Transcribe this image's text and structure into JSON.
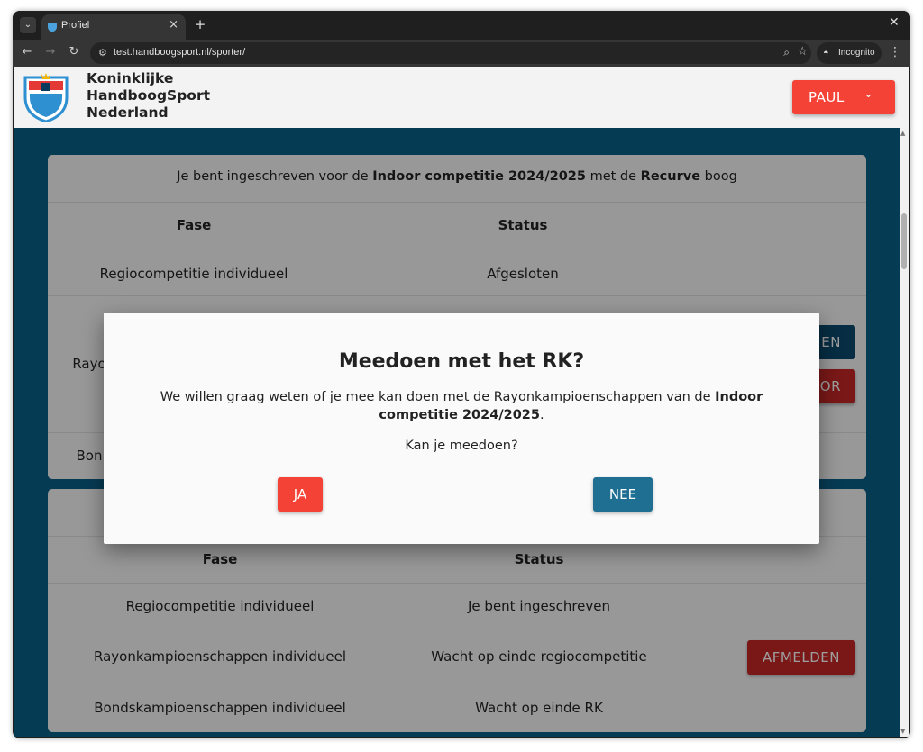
{
  "browser": {
    "tab_title": "Profiel",
    "url": "test.handboogsport.nl/sporter/",
    "incognito_label": "Incognito",
    "icons": {
      "tab_list": "chevron-down-icon",
      "back": "arrow-left-icon",
      "forward": "arrow-right-icon",
      "reload": "reload-icon",
      "site_info": "tune-icon",
      "zoom": "zoom-icon",
      "bookmark": "star-icon",
      "incognito": "incognito-icon",
      "menu": "more-vert-icon",
      "new_tab": "plus-icon",
      "minimize": "minimize-icon",
      "close": "close-icon"
    }
  },
  "header": {
    "site_name_lines": [
      "Koninklijke",
      "HandboogSport",
      "Nederland"
    ],
    "user_button": "PAUL",
    "colors": {
      "user_button": "#f44336",
      "page_background": "#0a6591"
    }
  },
  "card1": {
    "caption_pre": "Je bent ingeschreven voor de ",
    "caption_comp": "Indoor competitie 2024/2025",
    "caption_mid": " met de ",
    "caption_bow": "Recurve",
    "caption_post": " boog",
    "col_phase": "Fase",
    "col_status": "Status",
    "row1_phase": "Regiocompetitie individueel",
    "row1_status": "Afgesloten",
    "row2_phase_partial": "Rayo",
    "row2_button1_partial": "EN",
    "row2_button2_partial": "OR",
    "row3_phase_partial": "Bon"
  },
  "card2": {
    "col_phase": "Fase",
    "col_status": "Status",
    "rows": [
      {
        "phase": "Regiocompetitie individueel",
        "status": "Je bent ingeschreven"
      },
      {
        "phase": "Rayonkampioenschappen individueel",
        "status": "Wacht op einde regiocompetitie",
        "action": "AFMELDEN"
      },
      {
        "phase": "Bondskampioenschappen individueel",
        "status": "Wacht op einde RK"
      }
    ]
  },
  "modal": {
    "title": "Meedoen met het RK?",
    "text_pre": "We willen graag weten of je mee kan doen met de Rayonkampioenschappen van de ",
    "text_bold": "Indoor competitie 2024/2025",
    "text_post": ".",
    "question": "Kan je meedoen?",
    "yes_button": "JA",
    "no_button": "NEE",
    "colors": {
      "yes": "#f44336",
      "no": "#1f6f93"
    }
  }
}
